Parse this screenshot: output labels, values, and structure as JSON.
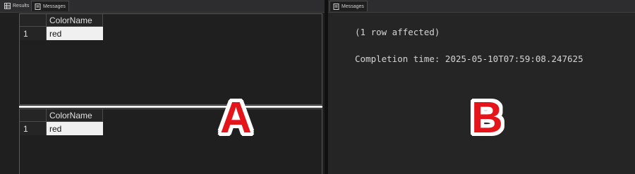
{
  "left_panel": {
    "tabs": [
      {
        "label": "Results",
        "icon": "grid-icon",
        "active": false
      },
      {
        "label": "Messages",
        "icon": "messages-icon",
        "active": true
      }
    ],
    "result_sets": [
      {
        "column_header": "ColorName",
        "row_number": "1",
        "value": "red"
      },
      {
        "column_header": "ColorName",
        "row_number": "1",
        "value": "red"
      }
    ],
    "overlay_label": "A"
  },
  "right_panel": {
    "tab": {
      "label": "Messages",
      "icon": "messages-icon"
    },
    "messages": [
      "(1 row affected)",
      "Completion time: 2025-05-10T07:59:08.247625"
    ],
    "overlay_label": "B"
  },
  "colors": {
    "overlay_red": "#e3151b",
    "overlay_outline": "#ffffff",
    "selected_cell_bg": "#f0f0f0"
  }
}
